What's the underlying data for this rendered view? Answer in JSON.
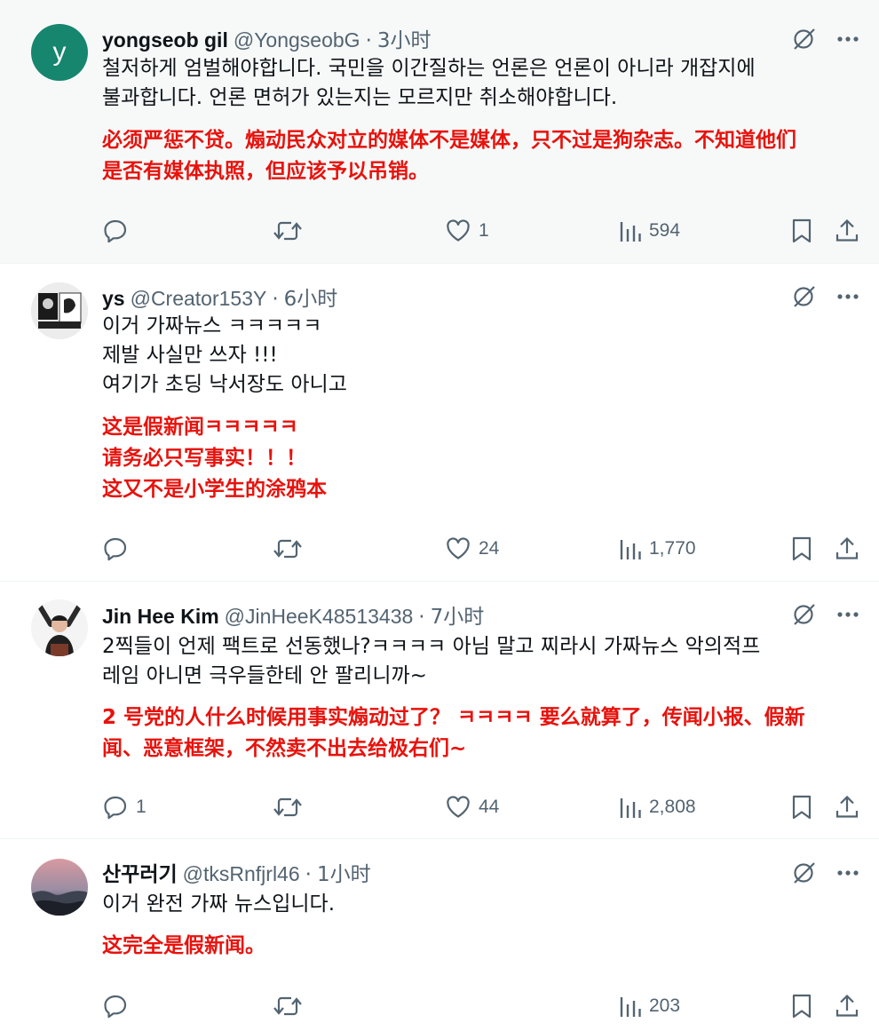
{
  "posts": [
    {
      "avatar_letter": "y",
      "name": "yongseob gil",
      "handle": "@YongseobG",
      "time": "3小时",
      "text_kr": "철저하게 엄벌해야합니다. 국민을 이간질하는 언론은 언론이 아니라 개잡지에\n불과합니다. 언론 면허가 있는지는 모르지만 취소해야합니다.",
      "text_cn": "必须严惩不贷。煽动民众对立的媒体不是媒体，只不过是狗杂志。不知道他们\n是否有媒体执照，但应该予以吊销。",
      "replies": "",
      "reposts": "",
      "likes": "1",
      "views": "594"
    },
    {
      "name": "ys",
      "handle": "@Creator153Y",
      "time": "6小时",
      "text_kr": "이거 가짜뉴스 ㅋㅋㅋㅋㅋ\n제발 사실만 쓰자 !!!\n여기가 초딩 낙서장도 아니고",
      "text_cn": "这是假新闻ㅋㅋㅋㅋㅋ\n请务必只写事实！！！\n这又不是小学生的涂鸦本",
      "replies": "",
      "reposts": "",
      "likes": "24",
      "views": "1,770"
    },
    {
      "name": "Jin Hee Kim",
      "handle": "@JinHeeK48513438",
      "time": "7小时",
      "text_kr": "2찍들이 언제 팩트로 선동했나?ㅋㅋㅋㅋ 아님 말고 찌라시 가짜뉴스 악의적프\n레임 아니면 극우들한테 안 팔리니까~",
      "text_cn": "2 号党的人什么时候用事实煽动过了？ ㅋㅋㅋㅋ 要么就算了，传闻小报、假新\n闻、恶意框架，不然卖不出去给极右们~",
      "replies": "1",
      "reposts": "",
      "likes": "44",
      "views": "2,808"
    },
    {
      "name": "산꾸러기",
      "handle": "@tksRnfjrl46",
      "time": "1小时",
      "text_kr": "이거 완전 가짜 뉴스입니다.",
      "text_cn": "这完全是假新闻。",
      "replies": "",
      "reposts": "",
      "likes": "",
      "views": "203"
    }
  ],
  "colors": {
    "accent_red": "#e8120c",
    "muted": "#536471",
    "avatar_green": "#16866e"
  },
  "icons": [
    "reply-icon",
    "repost-icon",
    "like-icon",
    "views-icon",
    "bookmark-icon",
    "share-icon",
    "grok-icon",
    "more-icon"
  ]
}
